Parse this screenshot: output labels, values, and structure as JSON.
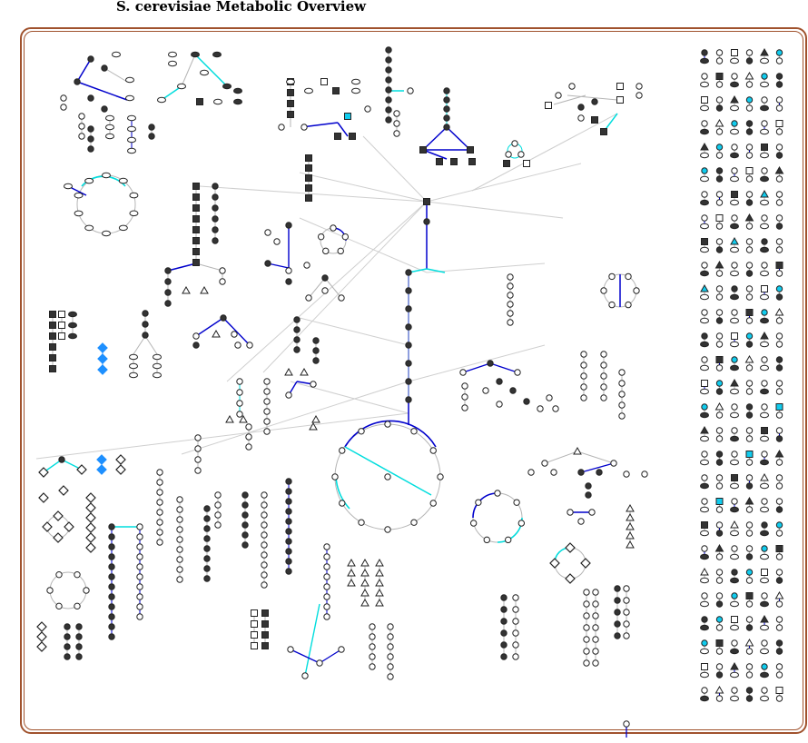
{
  "title": "S. cerevisiae Metabolic Overview",
  "colors": {
    "frame": "#a0522d",
    "node_fill_dark": "#333333",
    "node_stroke": "#222222",
    "edge_default": "#b5b5b5",
    "edge_highlight_blue": "#0000cc",
    "edge_highlight_cyan": "#00dddd",
    "node_cyan": "#11ccee",
    "diamond_blue": "#1e90ff"
  },
  "legend": {
    "node_shapes": [
      "circle",
      "square",
      "triangle",
      "diamond",
      "oval"
    ]
  }
}
